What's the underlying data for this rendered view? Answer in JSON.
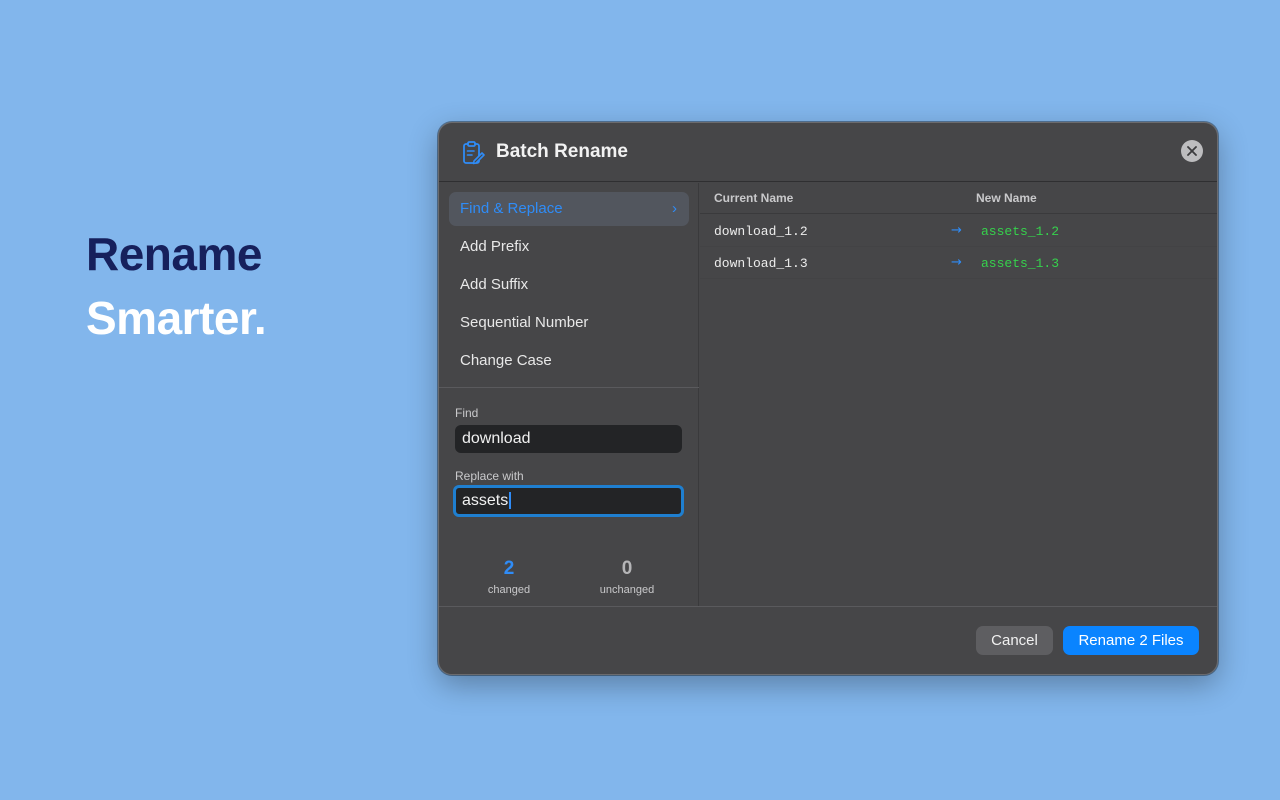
{
  "hero": {
    "line1": "Rename",
    "line2": "Smarter."
  },
  "dialog": {
    "title": "Batch Rename",
    "title_icon": "clipboard-edit-icon",
    "modes": [
      {
        "label": "Find & Replace",
        "active": true
      },
      {
        "label": "Add Prefix",
        "active": false
      },
      {
        "label": "Add Suffix",
        "active": false
      },
      {
        "label": "Sequential Number",
        "active": false
      },
      {
        "label": "Change Case",
        "active": false
      }
    ],
    "find": {
      "label": "Find",
      "value": "download"
    },
    "replace": {
      "label": "Replace with",
      "value": "assets"
    },
    "stats": {
      "changed": {
        "value": "2",
        "label": "changed"
      },
      "unchanged": {
        "value": "0",
        "label": "unchanged"
      }
    },
    "table": {
      "headers": {
        "current": "Current Name",
        "new": "New Name"
      },
      "rows": [
        {
          "current": "download_1.2",
          "new": "assets_1.2"
        },
        {
          "current": "download_1.3",
          "new": "assets_1.3"
        }
      ]
    },
    "buttons": {
      "cancel": "Cancel",
      "rename": "Rename 2 Files"
    }
  },
  "colors": {
    "background": "#82b6ec",
    "accent": "#0a84ff",
    "new_name": "#36d14c",
    "hero_dark": "#16205c"
  }
}
